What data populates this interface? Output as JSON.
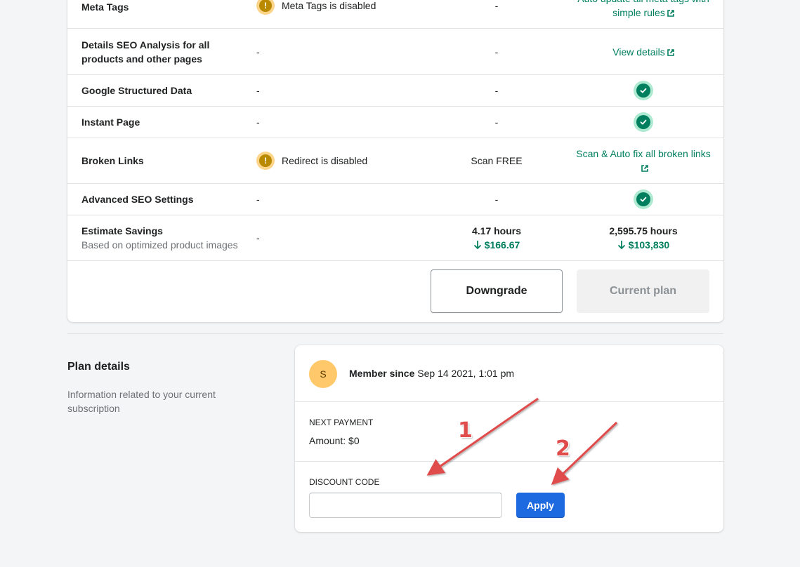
{
  "comparison": {
    "rows": [
      {
        "feature": "Meta Tags",
        "col2_text": "Meta Tags is disabled",
        "col3": "-",
        "col4_link": "Auto update all meta tags with simple rules"
      },
      {
        "feature": "Details SEO Analysis for all products and other pages",
        "col2": "-",
        "col3": "-",
        "col4_link": "View details"
      },
      {
        "feature": "Google Structured Data",
        "col2": "-",
        "col3": "-"
      },
      {
        "feature": "Instant Page",
        "col2": "-",
        "col3": "-"
      },
      {
        "feature": "Broken Links",
        "col2_text": "Redirect is disabled",
        "col3": "Scan FREE",
        "col4_link": "Scan & Auto fix all broken links"
      },
      {
        "feature": "Advanced SEO Settings",
        "col2": "-",
        "col3": "-"
      },
      {
        "feature": "Estimate Savings",
        "feature_sub": "Based on optimized product images",
        "col2": "-",
        "col3_hours": "4.17 hours",
        "col3_money": "$166.67",
        "col4_hours": "2,595.75 hours",
        "col4_money": "$103,830"
      }
    ],
    "warn_symbol": "!",
    "downgrade_label": "Downgrade",
    "current_plan_label": "Current plan"
  },
  "plan_details": {
    "title": "Plan details",
    "description": "Information related to your current subscription",
    "avatar_initial": "S",
    "member_label": "Member since",
    "member_date": "Sep 14 2021, 1:01 pm",
    "next_payment_label": "NEXT PAYMENT",
    "amount_text": "Amount: $0",
    "discount_label": "DISCOUNT CODE",
    "discount_value": "",
    "discount_placeholder": "",
    "apply_label": "Apply"
  },
  "annotations": {
    "arrow1_number": "1",
    "arrow2_number": "2"
  },
  "colors": {
    "accent_green": "#007f5f",
    "apply_blue": "#1d6ae0",
    "warning": "#b98900",
    "annotation_red": "#e04b4b"
  },
  "icons": [
    "warning-icon",
    "check-circle-icon",
    "external-link-icon",
    "arrow-down-icon"
  ]
}
